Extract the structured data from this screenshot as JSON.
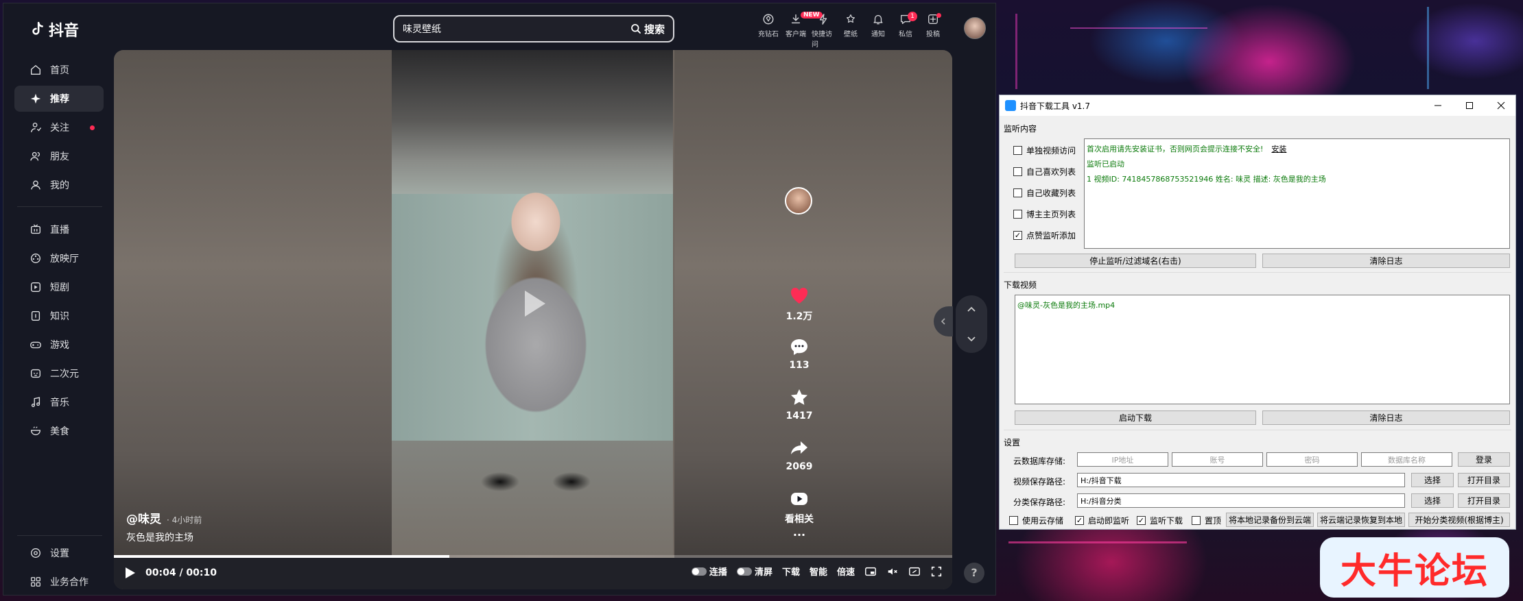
{
  "app": {
    "logo_text": "抖音"
  },
  "search": {
    "value": "味灵壁纸",
    "button": "搜索"
  },
  "top_icons": [
    {
      "label": "充钻石",
      "icon": "diamond-icon"
    },
    {
      "label": "客户端",
      "icon": "download-icon",
      "tag": "NEW"
    },
    {
      "label": "快捷访问",
      "icon": "lightning-icon"
    },
    {
      "label": "壁纸",
      "icon": "wallpaper-icon"
    },
    {
      "label": "通知",
      "icon": "bell-icon"
    },
    {
      "label": "私信",
      "icon": "message-icon",
      "badge": "1"
    },
    {
      "label": "投稿",
      "icon": "upload-icon"
    }
  ],
  "sidebar": {
    "group1": [
      "首页",
      "推荐",
      "关注",
      "朋友",
      "我的"
    ],
    "group2": [
      "直播",
      "放映厅",
      "短剧",
      "知识",
      "游戏",
      "二次元",
      "音乐",
      "美食"
    ],
    "bottom": [
      "设置",
      "业务合作"
    ]
  },
  "video": {
    "author": "@味灵",
    "time": "· 4小时前",
    "description": "灰色是我的主场",
    "likes": "1.2万",
    "comments": "113",
    "favorites": "1417",
    "shares": "2069",
    "related": "看相关",
    "more": "···",
    "progress": 0.4
  },
  "controls": {
    "time": "00:04 / 00:10",
    "autoplay": "连播",
    "clear": "清屏",
    "download": "下载",
    "smart": "智能",
    "speed": "倍速"
  },
  "tool": {
    "title": "抖音下载工具 v1.7",
    "monitor_section": "监听内容",
    "checkboxes": [
      {
        "label": "单独视频访问",
        "checked": false
      },
      {
        "label": "自己喜欢列表",
        "checked": false
      },
      {
        "label": "自己收藏列表",
        "checked": false
      },
      {
        "label": "博主主页列表",
        "checked": false
      },
      {
        "label": "点赞监听添加",
        "checked": true
      }
    ],
    "monitor_log": {
      "line1": "首次启用请先安装证书，否则网页会提示连接不安全!",
      "line1_link": "安装",
      "line2": "监听已启动",
      "line3": "1 视频ID: 7418457868753521946 姓名: 味灵 描述: 灰色是我的主场"
    },
    "btn_stop_monitor": "停止监听/过滤域名(右击)",
    "btn_clear_log1": "清除日志",
    "download_section": "下载视频",
    "download_log": "@味灵-灰色是我的主场.mp4",
    "btn_start_download": "启动下载",
    "btn_clear_log2": "清除日志",
    "settings_section": "设置",
    "cloud_label": "云数据库存储:",
    "cloud_ip": "IP地址",
    "cloud_account": "账号",
    "cloud_password": "密码",
    "cloud_dbname": "数据库名称",
    "btn_login": "登录",
    "video_path_label": "视频保存路径:",
    "video_path": "H:/抖音下载",
    "btn_select1": "选择",
    "btn_open1": "打开目录",
    "class_path_label": "分类保存路径:",
    "class_path": "H:/抖音分类",
    "btn_select2": "选择",
    "btn_open2": "打开目录",
    "opt_cloud": "使用云存储",
    "opt_auto_monitor": "启动即监听",
    "opt_monitor_download": "监听下载",
    "opt_top": "置顶",
    "btn_backup": "将本地记录备份到云端",
    "btn_restore": "将云端记录恢复到本地",
    "btn_classify": "开始分类视频(根据博主)"
  },
  "watermark": "大牛论坛"
}
